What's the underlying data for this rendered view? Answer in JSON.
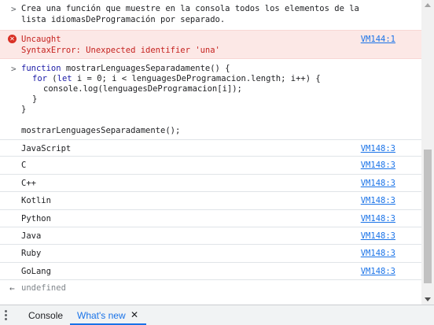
{
  "console": {
    "comment_lines": [
      "Crea una función que muestre en la consola todos los elementos de la",
      "lista idiomasDeProgramación por separado."
    ],
    "error": {
      "title": "Uncaught",
      "message": "SyntaxError: Unexpected identifier 'una'",
      "source": "VM144:1"
    },
    "code": {
      "line1_kw": "function",
      "line1_rest": " mostrarLenguagesSeparadamente() {",
      "line2_kw": "for",
      "line2_mid": " (",
      "line2_kw2": "let",
      "line2_rest": " i = 0; i < lenguagesDeProgramacion.length; i++) {",
      "line3": "console.log(lenguagesDeProgramacion[i]);",
      "line4": "}",
      "line5": "}",
      "line6": "mostrarLenguagesSeparadamente();"
    },
    "logs": [
      {
        "text": "JavaScript",
        "source": "VM148:3"
      },
      {
        "text": "C",
        "source": "VM148:3"
      },
      {
        "text": "C++",
        "source": "VM148:3"
      },
      {
        "text": "Kotlin",
        "source": "VM148:3"
      },
      {
        "text": "Python",
        "source": "VM148:3"
      },
      {
        "text": "Java",
        "source": "VM148:3"
      },
      {
        "text": "Ruby",
        "source": "VM148:3"
      },
      {
        "text": "GoLang",
        "source": "VM148:3"
      }
    ],
    "return_value": "undefined",
    "prompt_symbol": ">",
    "result_symbol": "←"
  },
  "drawer": {
    "tabs": [
      {
        "label": "Console",
        "active": false
      },
      {
        "label": "What's new",
        "active": true
      }
    ],
    "close_symbol": "✕"
  },
  "colors": {
    "accent": "#1a73e8",
    "error_bg": "#fce8e6",
    "error_text": "#c5221f"
  }
}
